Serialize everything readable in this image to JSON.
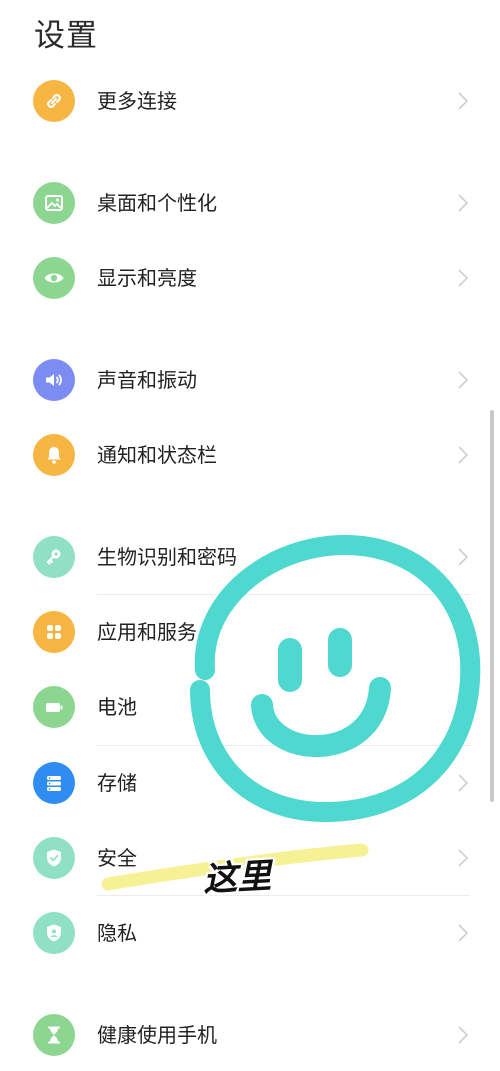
{
  "header": {
    "title": "设置"
  },
  "items": [
    {
      "label": "更多连接",
      "icon": "link-icon",
      "color": "#F7B643"
    },
    {
      "label": "桌面和个性化",
      "icon": "image-icon",
      "color": "#8CD692"
    },
    {
      "label": "显示和亮度",
      "icon": "eye-icon",
      "color": "#8CD692"
    },
    {
      "label": "声音和振动",
      "icon": "speaker-icon",
      "color": "#7B8CF2"
    },
    {
      "label": "通知和状态栏",
      "icon": "bell-icon",
      "color": "#F7B643"
    },
    {
      "label": "生物识别和密码",
      "icon": "key-icon",
      "color": "#8FE0C4"
    },
    {
      "label": "应用和服务",
      "icon": "apps-grid-icon",
      "color": "#F7B643"
    },
    {
      "label": "电池",
      "icon": "battery-icon",
      "color": "#8CD692"
    },
    {
      "label": "存储",
      "icon": "storage-icon",
      "color": "#2F8CF0"
    },
    {
      "label": "安全",
      "icon": "shield-check-icon",
      "color": "#8FE0C4"
    },
    {
      "label": "隐私",
      "icon": "privacy-shield-icon",
      "color": "#8FE0C4"
    },
    {
      "label": "健康使用手机",
      "icon": "hourglass-icon",
      "color": "#8CD692"
    }
  ],
  "overlay": {
    "annotation_text": "这里",
    "smiley_color": "#4FD8CF",
    "highlight_color": "#F5F08A"
  }
}
